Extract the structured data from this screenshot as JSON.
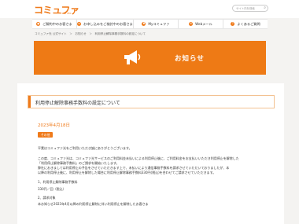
{
  "header": {
    "logo": "コミュファ",
    "logo_sub": "from ctc",
    "search_placeholder": "サイト内を検索"
  },
  "nav": {
    "items": [
      {
        "label": "ご解約中のお客さま",
        "icon": "user-icon"
      },
      {
        "label": "お申し込みをご検討中のお客さま",
        "icon": "document-icon"
      },
      {
        "label": "Myコミュファ",
        "icon": "heart-icon"
      },
      {
        "label": "Webメール",
        "icon": "mail-icon"
      },
      {
        "label": "よくあるご質問",
        "icon": "question-icon"
      }
    ]
  },
  "breadcrumb": "コミュファ光 公式サイト　＞　お知らせ　＞　利用停止解除事務手数料の設定について",
  "hero": {
    "title": "お知らせ",
    "icon": "megaphone-icon",
    "color": "#ee7a15"
  },
  "article": {
    "title": "利用停止解除事務手数料の設定について",
    "date": "2023年4月18日",
    "category": "その他",
    "lines": [
      "平素はコミュファ光をご利用いただき誠にありがとうございます。",
      "",
      "この度、コミュファ光は、コミュファ光サービスのご利用料金未払いによる利用停止後に、ご利用料金をお支払いいただき利用停止を解除した",
      "「利用停止解除事務手数料」のご請求を開始いたします。",
      "弊社におきましては利用停止の予告をさせていただきます上で、未払いにより通信事務手数料を請求させていただいておりましたが、本",
      "以降の利用停止後に、利用停止を解除した場合に利用停止解除事務手数料330円(税込)を合わせてご請求させていただきます。",
      "",
      "1、利用停止解除事務手数料",
      "330円／回（税込）",
      "",
      "2、請求対象",
      "本お知らせ2023年4月以降の利用停止解除に伴い利用停止を解除したお客さま"
    ]
  }
}
